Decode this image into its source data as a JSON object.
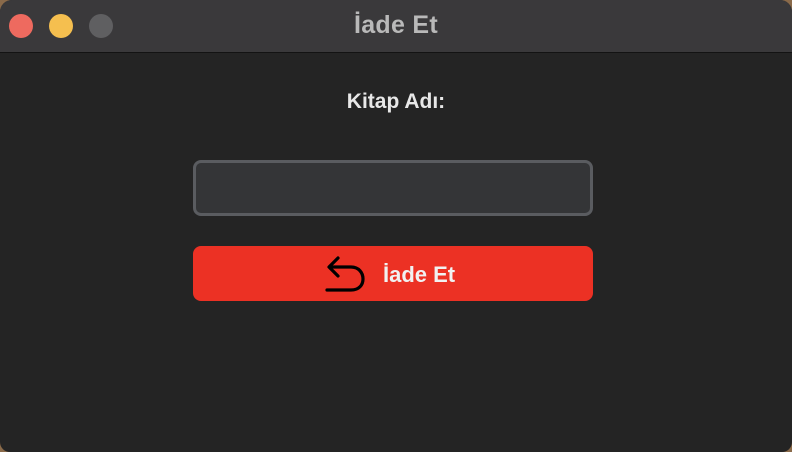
{
  "window": {
    "title": "İade Et",
    "controls": {
      "close": "close-button",
      "minimize": "minimize-button",
      "zoom": "zoom-button"
    }
  },
  "form": {
    "book_label": "Kitap Adı:",
    "book_input_value": "",
    "book_input_placeholder": "",
    "return_button_label": "İade Et",
    "return_button_icon": "return-arrow-icon"
  },
  "colors": {
    "window_background": "#242424",
    "titlebar": "#3a393b",
    "input_background": "#343537",
    "input_border": "#5a5c60",
    "button_accent": "#ec3124",
    "close": "#ee6a5f",
    "minimize": "#f5bf4f",
    "zoom": "#5f5f61"
  }
}
